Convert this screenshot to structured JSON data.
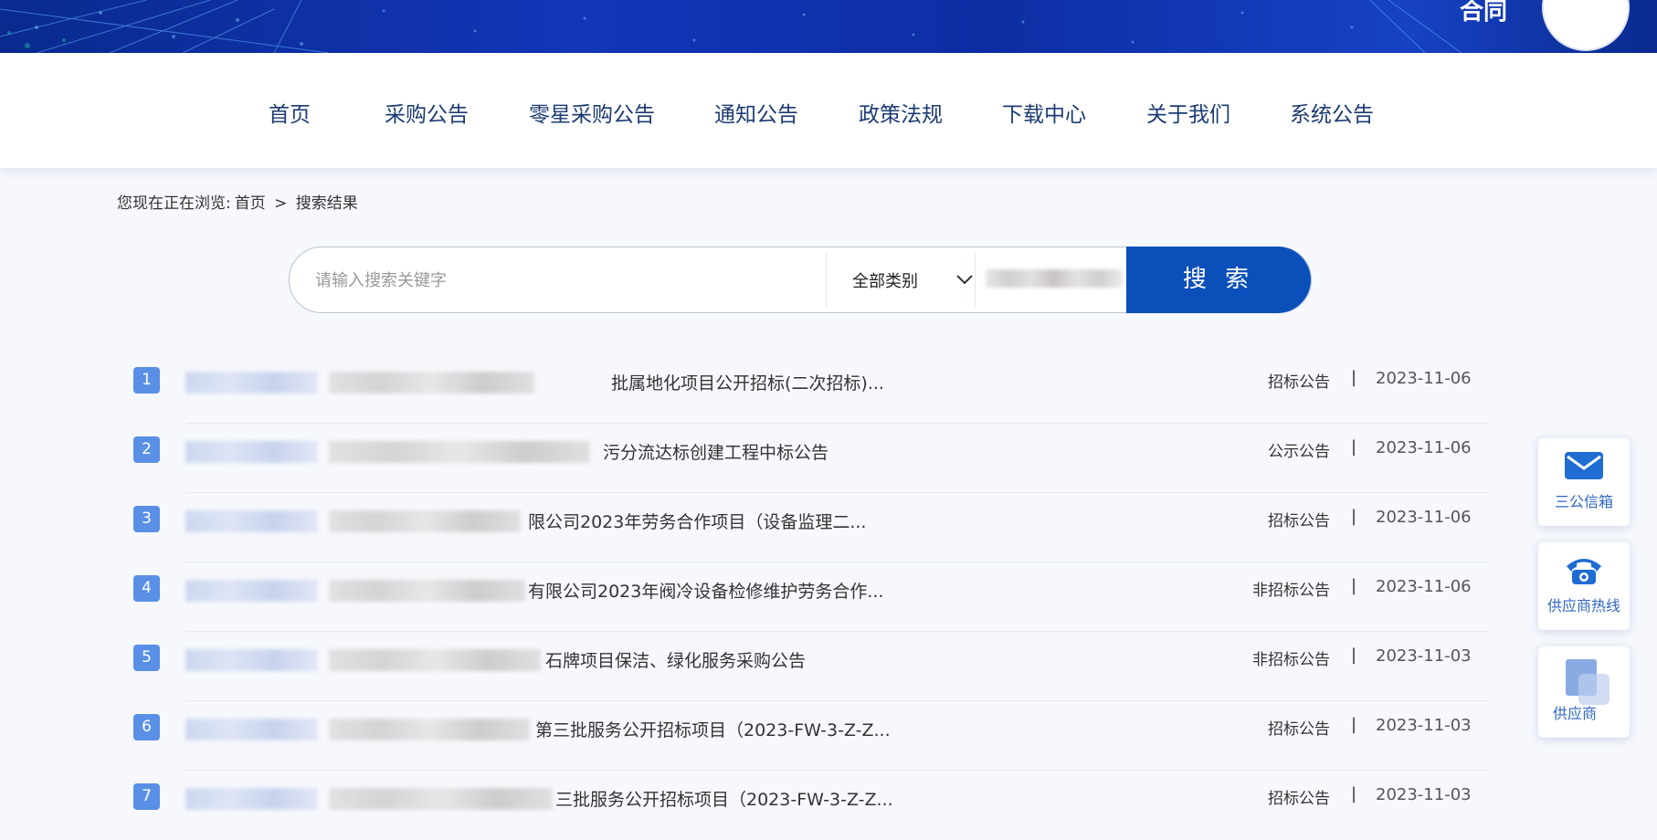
{
  "banner": {
    "text": "合同"
  },
  "nav": {
    "items": [
      "首页",
      "采购公告",
      "零星采购公告",
      "通知公告",
      "政策法规",
      "下载中心",
      "关于我们",
      "系统公告"
    ]
  },
  "breadcrumb": {
    "prefix": "您现在正在浏览:",
    "home": "首页",
    "sep": ">",
    "current": "搜索结果"
  },
  "search": {
    "placeholder": "请输入搜索关键字",
    "category": "全部类别",
    "button": "搜 索"
  },
  "results": [
    {
      "num": "1",
      "title": "批属地化项目公开招标(二次招标)...",
      "category": "招标公告",
      "date": "2023-11-06"
    },
    {
      "num": "2",
      "title": "污分流达标创建工程中标公告",
      "category": "公示公告",
      "date": "2023-11-06"
    },
    {
      "num": "3",
      "title": "限公司2023年劳务合作项目（设备监理二...",
      "category": "招标公告",
      "date": "2023-11-06"
    },
    {
      "num": "4",
      "title": "有限公司2023年阀冷设备检修维护劳务合作...",
      "category": "非招标公告",
      "date": "2023-11-06"
    },
    {
      "num": "5",
      "title": "石牌项目保洁、绿化服务采购公告",
      "category": "非招标公告",
      "date": "2023-11-03"
    },
    {
      "num": "6",
      "title": "第三批服务公开招标项目（2023-FW-3-Z-Z...",
      "category": "招标公告",
      "date": "2023-11-03"
    },
    {
      "num": "7",
      "title": "三批服务公开招标项目（2023-FW-3-Z-Z...",
      "category": "招标公告",
      "date": "2023-11-03"
    }
  ],
  "side": {
    "mailbox": "三公信箱",
    "hotline": "供应商热线",
    "supplier": "供应商"
  },
  "colors": {
    "accent": "#0b4fbb",
    "nav_text": "#1c3b72",
    "badge": "#5a8fe6"
  }
}
